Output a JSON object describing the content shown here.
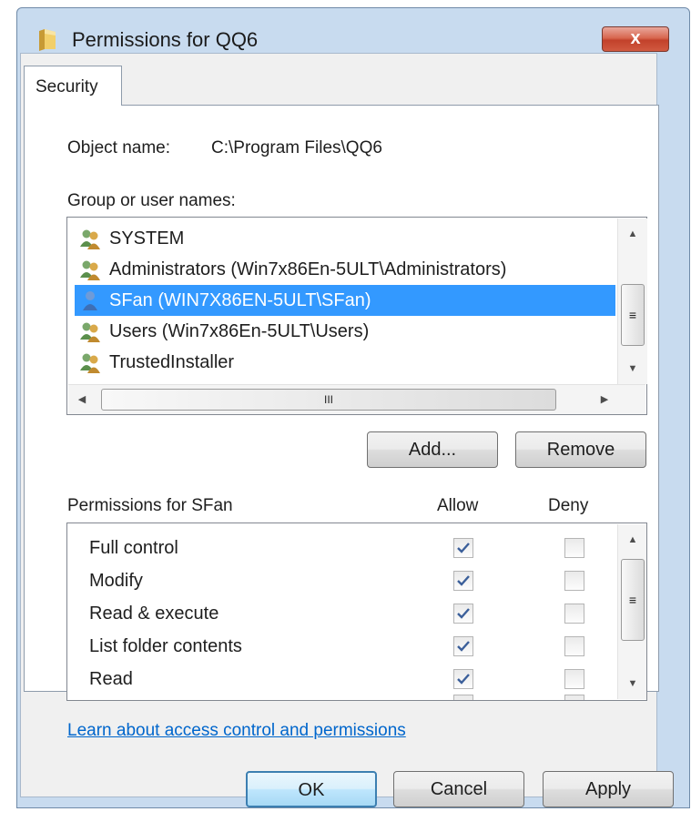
{
  "window": {
    "title": "Permissions for QQ6",
    "close_symbol": "x",
    "icon": "folder-icon"
  },
  "tabs": [
    {
      "label": "Security",
      "active": true
    }
  ],
  "object": {
    "label": "Object name:",
    "value": "C:\\Program Files\\QQ6"
  },
  "group_list": {
    "label": "Group or user names:",
    "items": [
      {
        "name": "SYSTEM",
        "icon": "users-group-icon",
        "selected": false
      },
      {
        "name": "Administrators (Win7x86En-5ULT\\Administrators)",
        "icon": "users-group-icon",
        "selected": false
      },
      {
        "name": "SFan (WIN7X86EN-5ULT\\SFan)",
        "icon": "single-user-icon",
        "selected": true
      },
      {
        "name": "Users (Win7x86En-5ULT\\Users)",
        "icon": "users-group-icon",
        "selected": false
      },
      {
        "name": "TrustedInstaller",
        "icon": "users-group-icon",
        "selected": false
      }
    ],
    "hscroll_grip": "III",
    "vscroll_grip": "≡"
  },
  "buttons": {
    "add": "Add...",
    "remove": "Remove",
    "ok": "OK",
    "cancel": "Cancel",
    "apply": "Apply"
  },
  "permissions": {
    "label": "Permissions for SFan",
    "allow_header": "Allow",
    "deny_header": "Deny",
    "items": [
      {
        "name": "Full control",
        "allow": true,
        "deny": false
      },
      {
        "name": "Modify",
        "allow": true,
        "deny": false
      },
      {
        "name": "Read & execute",
        "allow": true,
        "deny": false
      },
      {
        "name": "List folder contents",
        "allow": true,
        "deny": false
      },
      {
        "name": "Read",
        "allow": true,
        "deny": false
      }
    ],
    "vscroll_grip": "≡"
  },
  "link": "Learn about access control and permissions",
  "colors": {
    "selection": "#3399ff",
    "link": "#0066cc",
    "close_button": "#c2412b",
    "frame": "#c8dbef"
  }
}
